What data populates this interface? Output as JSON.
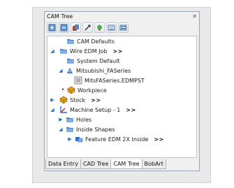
{
  "window": {
    "title": "CAM Tree"
  },
  "toolbar": {
    "buttons": [
      {
        "icon": "expand-tree-icon"
      },
      {
        "icon": "collapse-tree-icon"
      },
      {
        "icon": "copy-icon"
      },
      {
        "icon": "delete-icon"
      },
      {
        "icon": "tool-icon"
      },
      {
        "icon": "list-icon"
      },
      {
        "icon": "properties-icon"
      }
    ]
  },
  "tree": {
    "nodes": [
      {
        "label": "CAM Defaults",
        "more": ""
      },
      {
        "label": "Wire EDM Job",
        "more": ">>"
      },
      {
        "label": "System Default",
        "more": ""
      },
      {
        "label": "Mitsubishi_FASeries",
        "more": ""
      },
      {
        "label": "MitsFASeries.EDMPST",
        "more": ""
      },
      {
        "label": "Workpiece",
        "more": ""
      },
      {
        "label": "Stock",
        "more": ">>"
      },
      {
        "label": "Machine Setup - 1",
        "more": ">>"
      },
      {
        "label": "Holes",
        "more": ""
      },
      {
        "label": "Inside Shapes",
        "more": ""
      },
      {
        "label": "Feature EDM 2X Inside",
        "more": ">>"
      }
    ]
  },
  "tabs": [
    {
      "label": "Data Entry"
    },
    {
      "label": "CAD Tree"
    },
    {
      "label": "CAM Tree"
    },
    {
      "label": "BobArt"
    }
  ],
  "colors": {
    "accent_blue": "#2b6fc2",
    "folder_blue": "#4a86c8",
    "workpiece_orange": "#e0a020",
    "red_marker": "#d02020"
  }
}
